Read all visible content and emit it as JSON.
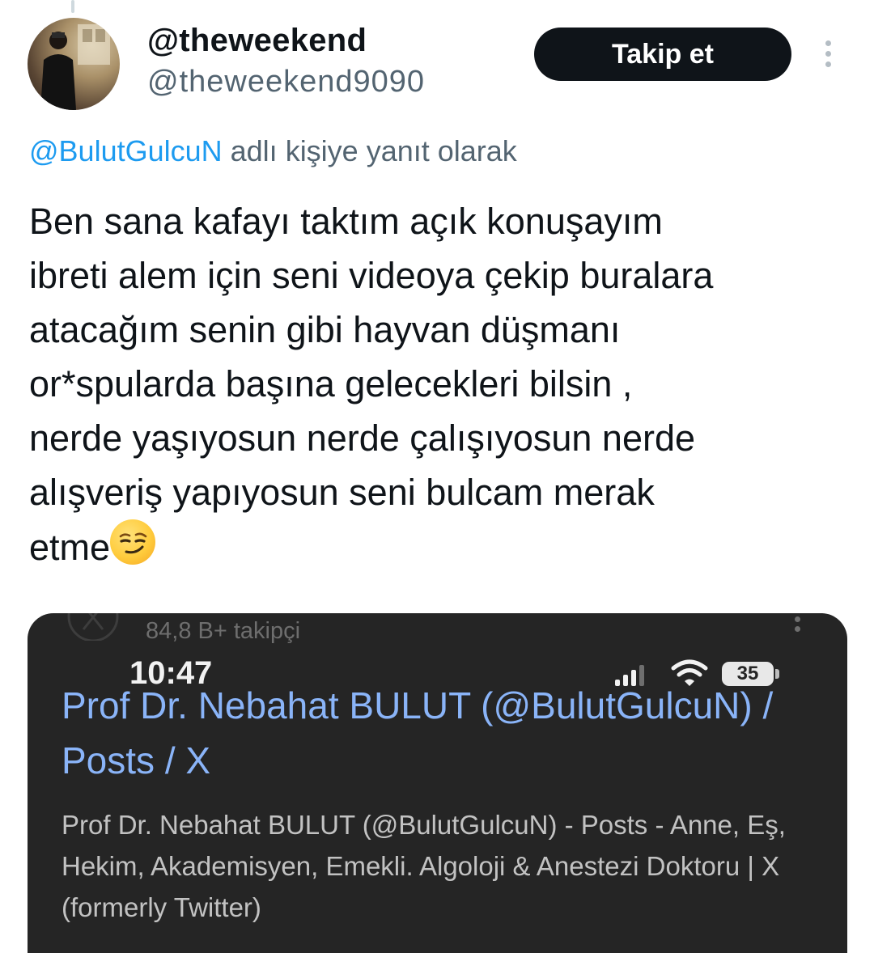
{
  "tweet": {
    "display_name": "@theweekend",
    "handle": "@theweekend9090",
    "follow_label": "Takip et",
    "reply_to_mention": "@BulutGulcuN",
    "reply_to_suffix": " adlı kişiye yanıt olarak",
    "body": "Ben sana kafayı taktım açık konuşayım\nibreti alem için seni videoya çekip buralara\natacağım senin gibi hayvan düşmanı\nor*spularda başına gelecekleri bilsin ,\nnerde yaşıyosun nerde çalışıyosun nerde\nalışveriş yapıyosun seni bulcam merak\netme",
    "emoji": "smirking-face"
  },
  "attached_screenshot": {
    "followers_text": "84,8 B+ takipçi",
    "status_time": "10:47",
    "battery_level": "35",
    "result_title": "Prof Dr. Nebahat BULUT (@BulutGulcuN) / Posts / X",
    "result_description": "Prof Dr. Nebahat BULUT (@BulutGulcuN) - Posts - Anne, Eş, Hekim, Akademisyen, Emekli. Algoloji & Anestezi Doktoru | X (formerly Twitter)",
    "icons": [
      "x-logo-icon",
      "signal-icon",
      "wifi-icon",
      "battery-icon"
    ]
  }
}
